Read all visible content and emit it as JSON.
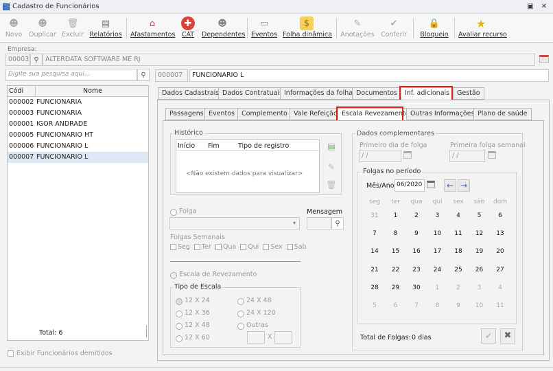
{
  "window": {
    "title": "Cadastro de Funcionários"
  },
  "toolbar": [
    {
      "name": "novo",
      "label": "Novo",
      "enabled": false,
      "icon": "new-user-icon"
    },
    {
      "name": "duplicar",
      "label": "Duplicar",
      "enabled": false,
      "icon": "duplicate-users-icon"
    },
    {
      "name": "excluir",
      "label": "Excluir",
      "enabled": false,
      "icon": "trash-icon"
    },
    {
      "name": "relatorios",
      "label": "Relatórios",
      "enabled": true,
      "icon": "report-icon"
    },
    {
      "name": "afastamentos",
      "label": "Afastamentos",
      "enabled": true,
      "icon": "leave-house-icon"
    },
    {
      "name": "cat",
      "label": "CAT",
      "enabled": true,
      "icon": "red-cross-icon"
    },
    {
      "name": "dependentes",
      "label": "Dependentes",
      "enabled": true,
      "icon": "dependents-icon"
    },
    {
      "name": "eventos",
      "label": "Eventos",
      "enabled": true,
      "icon": "events-icon"
    },
    {
      "name": "folha",
      "label": "Folha dinâmica",
      "enabled": true,
      "icon": "payroll-icon"
    },
    {
      "name": "anotacoes",
      "label": "Anotações",
      "enabled": false,
      "icon": "annotation-icon"
    },
    {
      "name": "conferir",
      "label": "Conferir",
      "enabled": false,
      "icon": "check-document-icon"
    },
    {
      "name": "bloqueio",
      "label": "Bloqueio",
      "enabled": true,
      "icon": "lock-icon"
    },
    {
      "name": "avaliar",
      "label": "Avaliar recurso",
      "enabled": true,
      "icon": "star-icon"
    }
  ],
  "empresa": {
    "label": "Empresa:",
    "code": "00003",
    "name": "ALTERDATA SOFTWARE ME RJ"
  },
  "search": {
    "placeholder": "Digite sua pesquisa aqui..."
  },
  "employee": {
    "code": "000007",
    "name": "FUNCIONARIO L"
  },
  "list": {
    "col_code": "Códi",
    "col_name": "Nome",
    "rows": [
      {
        "code": "000002",
        "name": "FUNCIONARIA"
      },
      {
        "code": "000003",
        "name": "FUNCIONARIA"
      },
      {
        "code": "000001",
        "name": "IGOR ANDRADE"
      },
      {
        "code": "000005",
        "name": "FUNCIONARIO HT"
      },
      {
        "code": "000006",
        "name": "FUNCIONARIO L"
      },
      {
        "code": "000007",
        "name": "FUNCIONARIO L"
      }
    ],
    "total": "Total: 6"
  },
  "exibir_demitidos": "Exibir Funcionários demitidos",
  "tabs": [
    "Dados Cadastrais",
    "Dados Contratuais",
    "Informações da folha",
    "Documentos",
    "Inf. adicionais",
    "Gestão"
  ],
  "subtabs": [
    "Passagens",
    "Eventos",
    "Complemento",
    "Vale Refeição",
    "Escala Revezamento",
    "Outras Informações",
    "Plano de saúde"
  ],
  "historico": {
    "title": "Histórico",
    "col_inicio": "Início",
    "col_fim": "Fim",
    "col_tipo": "Tipo de registro",
    "empty": "<Não existem dados para visualizar>"
  },
  "folga": {
    "label": "Folga",
    "mensagem": "Mensagem",
    "semanais": "Folgas Semanais",
    "days": [
      "Seg",
      "Ter",
      "Qua",
      "Qui",
      "Sex",
      "Sab"
    ]
  },
  "escala": {
    "label": "Escala de Revezamento",
    "tipo": "Tipo de Escala",
    "options_left": [
      "12 X 24",
      "12 X 36",
      "12 X 48",
      "12 X 60"
    ],
    "options_right": [
      "24 X 48",
      "24 X 120",
      "Outras"
    ],
    "x": "X"
  },
  "dados": {
    "title": "Dados complementares",
    "primeiro_dia": "Primeiro dia de folga",
    "primeira_semanal": "Primeira folga semanal",
    "date_placeholder": "/ /"
  },
  "folgas_periodo": {
    "title": "Folgas no período",
    "mes_ano_label": "Mês/Ano",
    "mes_ano": "06/2020"
  },
  "calendar": {
    "weekdays": [
      "seg",
      "ter",
      "qua",
      "qui",
      "sex",
      "sáb",
      "dom"
    ],
    "weeks": [
      [
        "31",
        "1",
        "2",
        "3",
        "4",
        "5",
        "6"
      ],
      [
        "7",
        "8",
        "9",
        "10",
        "11",
        "12",
        "13"
      ],
      [
        "14",
        "15",
        "16",
        "17",
        "18",
        "19",
        "20"
      ],
      [
        "21",
        "22",
        "23",
        "24",
        "25",
        "26",
        "27"
      ],
      [
        "28",
        "29",
        "30",
        "1",
        "2",
        "3",
        "4"
      ],
      [
        "5",
        "6",
        "7",
        "8",
        "9",
        "10",
        "11"
      ]
    ]
  },
  "total_folgas": {
    "label": "Total de Folgas:",
    "value": "0 dias"
  }
}
